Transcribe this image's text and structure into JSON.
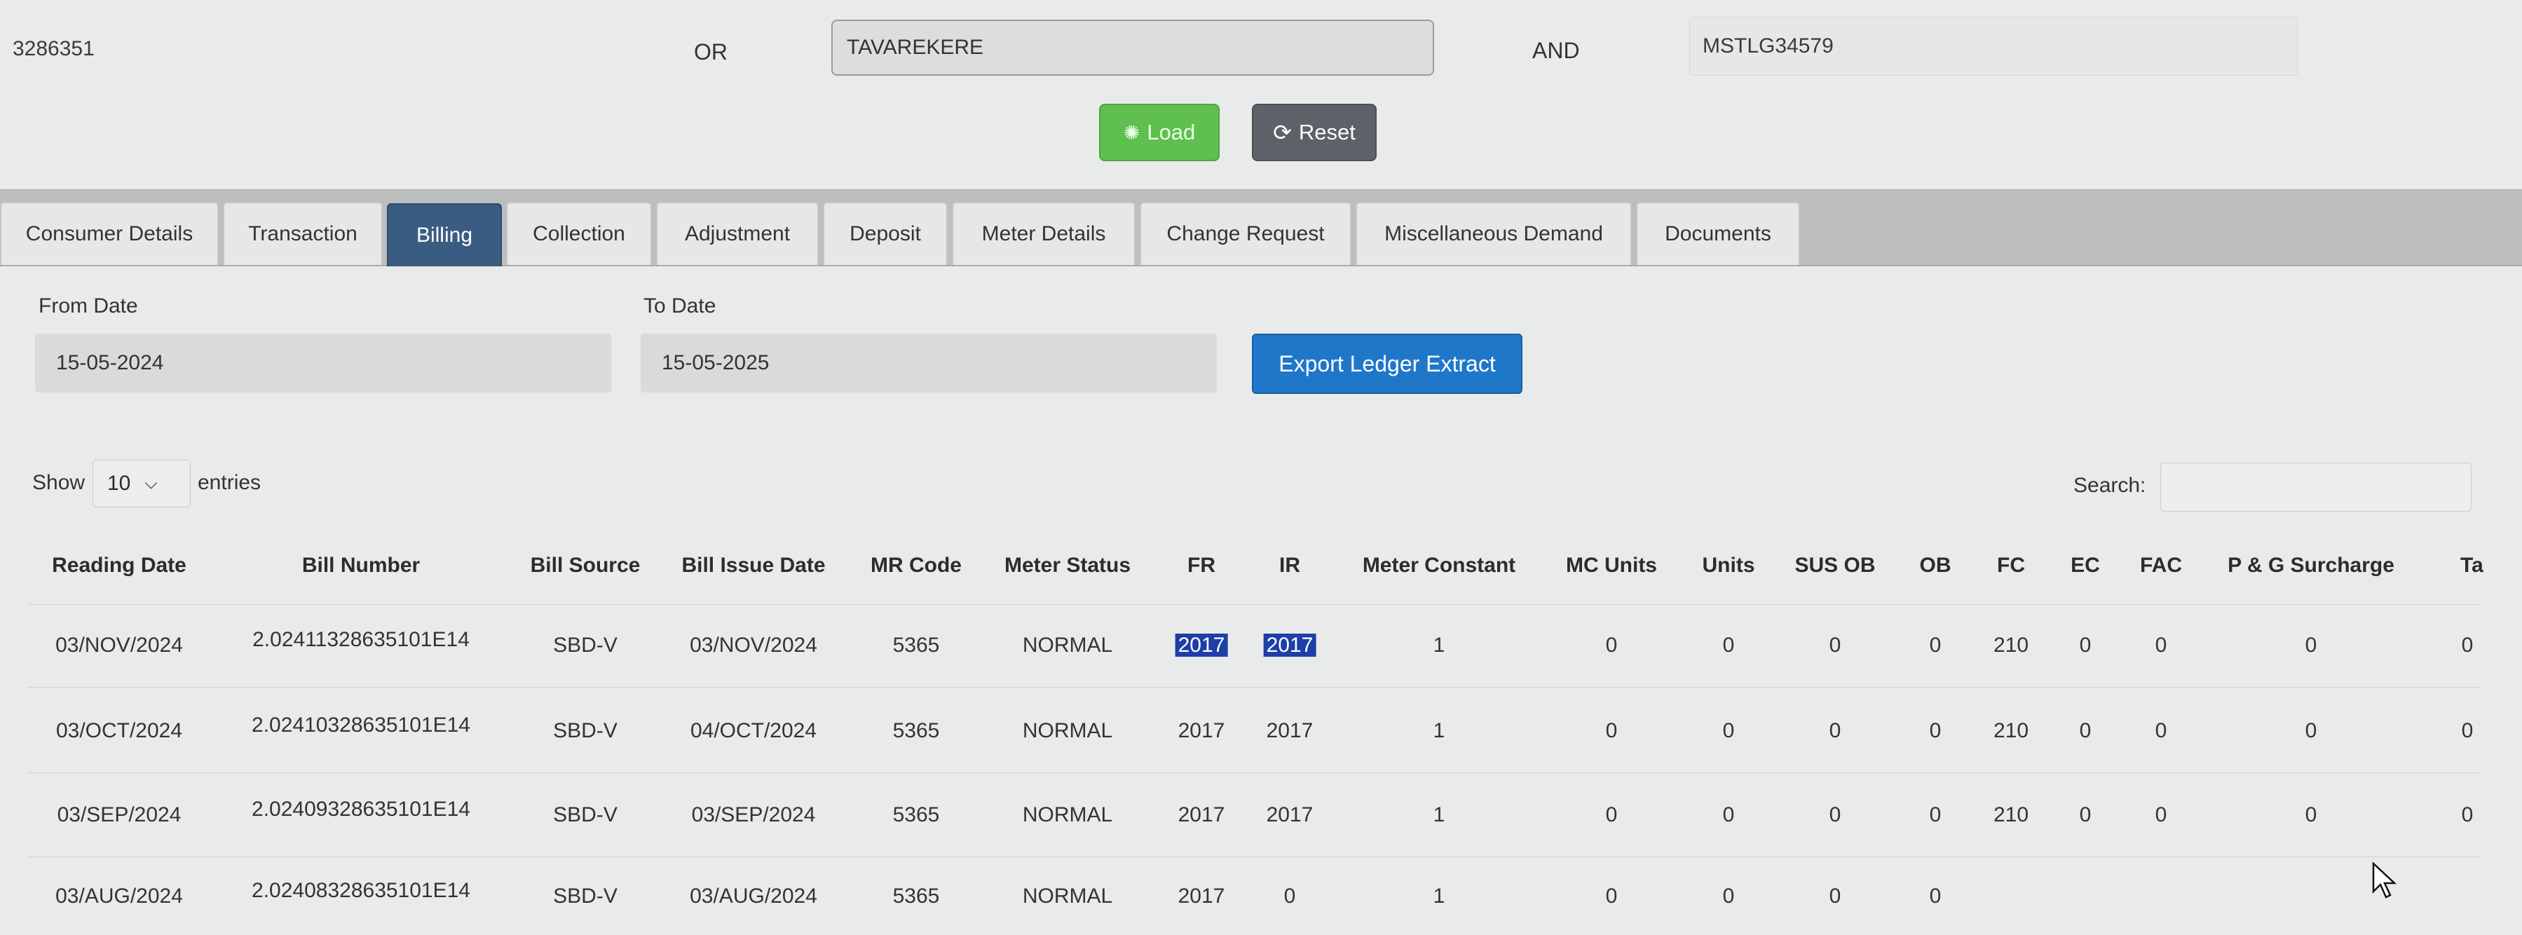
{
  "top": {
    "field1": "3286351",
    "or_label": "OR",
    "search_value": "TAVAREKERE",
    "and_label": "AND",
    "field3": "MSTLG34579"
  },
  "actions": {
    "load": "Load",
    "reset": "Reset"
  },
  "tabs": [
    "Consumer Details",
    "Transaction",
    "Billing",
    "Collection",
    "Adjustment",
    "Deposit",
    "Meter Details",
    "Change Request",
    "Miscellaneous Demand",
    "Documents"
  ],
  "active_tab": "Billing",
  "filters": {
    "from_label": "From Date",
    "from_value": "15-05-2024",
    "to_label": "To Date",
    "to_value": "15-05-2025",
    "export_label": "Export Ledger Extract"
  },
  "table_controls": {
    "show_label": "Show",
    "entries_value": "10",
    "entries_label": "entries",
    "search_label": "Search:"
  },
  "table": {
    "headers": [
      "Reading Date",
      "Bill Number",
      "Bill Source",
      "Bill Issue Date",
      "MR Code",
      "Meter Status",
      "FR",
      "IR",
      "Meter Constant",
      "MC Units",
      "Units",
      "SUS OB",
      "OB",
      "FC",
      "EC",
      "FAC",
      "P & G Surcharge",
      "Ta"
    ],
    "rows": [
      [
        "03/NOV/2024",
        "2.02411328635101E14",
        "SBD-V",
        "03/NOV/2024",
        "5365",
        "NORMAL",
        "2017",
        "2017",
        "1",
        "0",
        "0",
        "0",
        "0",
        "210",
        "0",
        "0",
        "0",
        "0"
      ],
      [
        "03/OCT/2024",
        "2.02410328635101E14",
        "SBD-V",
        "04/OCT/2024",
        "5365",
        "NORMAL",
        "2017",
        "2017",
        "1",
        "0",
        "0",
        "0",
        "0",
        "210",
        "0",
        "0",
        "0",
        "0"
      ],
      [
        "03/SEP/2024",
        "2.02409328635101E14",
        "SBD-V",
        "03/SEP/2024",
        "5365",
        "NORMAL",
        "2017",
        "2017",
        "1",
        "0",
        "0",
        "0",
        "0",
        "210",
        "0",
        "0",
        "0",
        "0"
      ],
      [
        "03/AUG/2024",
        "2.02408328635101E14",
        "SBD-V",
        "03/AUG/2024",
        "5365",
        "NORMAL",
        "2017",
        "0",
        "1",
        "0",
        "0",
        "0",
        "0",
        "",
        "",
        "",
        "",
        ""
      ]
    ]
  }
}
